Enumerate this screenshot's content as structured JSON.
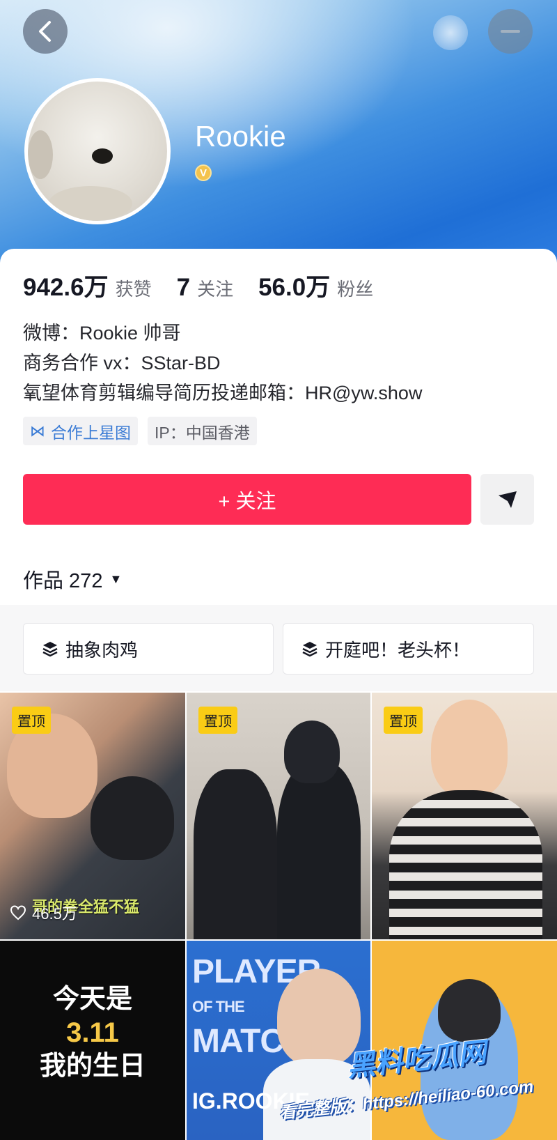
{
  "profile": {
    "name": "Rookie",
    "verify_text": "",
    "verify_badge": "V"
  },
  "stats": [
    {
      "value": "942.6万",
      "label": "获赞"
    },
    {
      "value": "7",
      "label": "关注"
    },
    {
      "value": "56.0万",
      "label": "粉丝"
    }
  ],
  "bio": {
    "line1": "微博：Rookie 帅哥",
    "line2": "商务合作 vx：SStar-BD",
    "line3": "氧望体育剪辑编导简历投递邮箱：HR@yw.show"
  },
  "tags": {
    "xingtu": "合作上星图",
    "ip": "IP：中国香港"
  },
  "actions": {
    "follow": "+ 关注"
  },
  "works": {
    "label": "作品 272",
    "caret": "▼"
  },
  "collections": [
    {
      "label": "抽象肉鸡"
    },
    {
      "label": "开庭吧！老头杯！"
    }
  ],
  "videos": [
    {
      "pin": "置顶",
      "likes": "46.5万",
      "subtitle": "哥的拳全猛不猛"
    },
    {
      "pin": "置顶"
    },
    {
      "pin": "置顶"
    },
    {
      "text_line1": "今天是",
      "text_line2": "3.11",
      "text_line3": "我的生日"
    },
    {
      "text_line1": "PLAYER",
      "text_line2": "OF THE",
      "text_line3": "MATCH",
      "text_line4": "IG.ROOKIE"
    },
    {}
  ],
  "watermark": {
    "brand": "黑料吃瓜网",
    "url": "看完整版：https://heiliao-60.com"
  },
  "colors": {
    "accent": "#fe2c55",
    "link": "#3a7bd5",
    "pin": "#facc15"
  }
}
